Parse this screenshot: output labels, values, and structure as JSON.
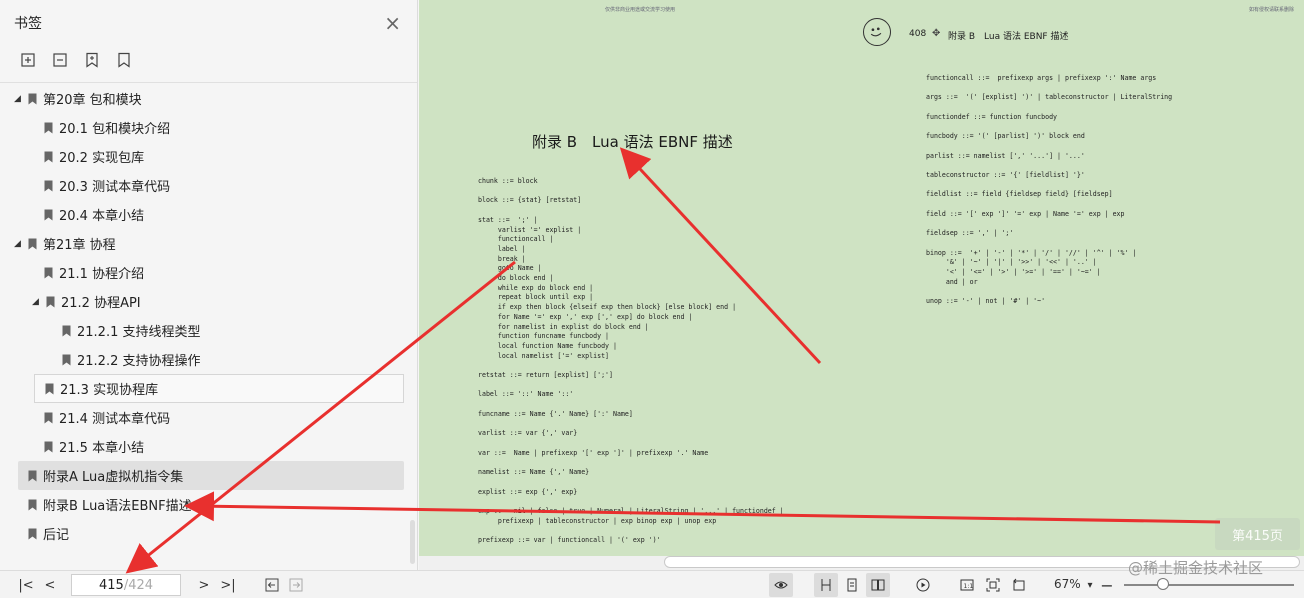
{
  "sidebar": {
    "title": "书签",
    "close": "×",
    "tools": [
      "expand-bookmark-icon",
      "collapse-bookmark-icon",
      "add-bookmark-icon",
      "bookmark-icon"
    ],
    "items": [
      {
        "label": "第20章 包和模块",
        "level": 0,
        "caret": "◢"
      },
      {
        "label": "20.1 包和模块介绍",
        "level": 1
      },
      {
        "label": "20.2 实现包库",
        "level": 1
      },
      {
        "label": "20.3 测试本章代码",
        "level": 1
      },
      {
        "label": "20.4 本章小结",
        "level": 1
      },
      {
        "label": "第21章 协程",
        "level": 0,
        "caret": "◢"
      },
      {
        "label": "21.1 协程介绍",
        "level": 1
      },
      {
        "label": "21.2 协程API",
        "level": 1,
        "caret": "◢"
      },
      {
        "label": "21.2.1 支持线程类型",
        "level": 2
      },
      {
        "label": "21.2.2 支持协程操作",
        "level": 2
      },
      {
        "label": "21.3 实现协程库",
        "level": 1
      },
      {
        "label": "21.4 测试本章代码",
        "level": 1
      },
      {
        "label": "21.5 本章小结",
        "level": 1
      },
      {
        "label": "附录A Lua虚拟机指令集",
        "level": 0
      },
      {
        "label": "附录B Lua语法EBNF描述",
        "level": 0
      },
      {
        "label": "后记",
        "level": 0
      }
    ]
  },
  "page": {
    "header_left": "仅供非商业用途或交流学习使用",
    "header_right": "如有侵权请联系删除",
    "page_number": "408",
    "appendix_header": "附录 B　Lua 语法 EBNF 描述",
    "big_title": "附录 B　Lua 语法 EBNF 描述",
    "code_left": "chunk ::= block\n\nblock ::= {stat} [retstat]\n\nstat ::=  ';' |\n     varlist '=' explist |\n     functioncall |\n     label |\n     break |\n     goto Name |\n     do block end |\n     while exp do block end |\n     repeat block until exp |\n     if exp then block {elseif exp then block} [else block] end |\n     for Name '=' exp ',' exp [',' exp] do block end |\n     for namelist in explist do block end |\n     function funcname funcbody |\n     local function Name funcbody |\n     local namelist ['=' explist]\n\nretstat ::= return [explist] [';']\n\nlabel ::= '::' Name '::'\n\nfuncname ::= Name {'.' Name} [':' Name]\n\nvarlist ::= var {',' var}\n\nvar ::=  Name | prefixexp '[' exp ']' | prefixexp '.' Name\n\nnamelist ::= Name {',' Name}\n\nexplist ::= exp {',' exp}\n\nexp ::=  nil | false | true | Numeral | LiteralString | '...' | functiondef |\n     prefixexp | tableconstructor | exp binop exp | unop exp\n\nprefixexp ::= var | functioncall | '(' exp ')'",
    "code_right": "functioncall ::=  prefixexp args | prefixexp ':' Name args\n\nargs ::=  '(' [explist] ')' | tableconstructor | LiteralString\n\nfunctiondef ::= function funcbody\n\nfuncbody ::= '(' [parlist] ')' block end\n\nparlist ::= namelist [',' '...'] | '...'\n\ntableconstructor ::= '{' [fieldlist] '}'\n\nfieldlist ::= field {fieldsep field} [fieldsep]\n\nfield ::= '[' exp ']' '=' exp | Name '=' exp | exp\n\nfieldsep ::= ',' | ';'\n\nbinop ::=  '+' | '-' | '*' | '/' | '//' | '^' | '%' |\n     '&' | '~' | '|' | '>>' | '<<' | '..' |\n     '<' | '<=' | '>' | '>=' | '==' | '~=' |\n     and | or\n\nunop ::= '-' | not | '#' | '~'",
    "page_badge": "第415页"
  },
  "toolbar": {
    "current_page": "415",
    "total_pages": "/424",
    "zoom": "67%",
    "zoom_level": 0.23
  },
  "watermark": "@稀土掘金技术社区",
  "colors": {
    "page_bg": "#cfe3c3",
    "arrow": "#e8302e",
    "selected_item": "#e0e0e0"
  }
}
